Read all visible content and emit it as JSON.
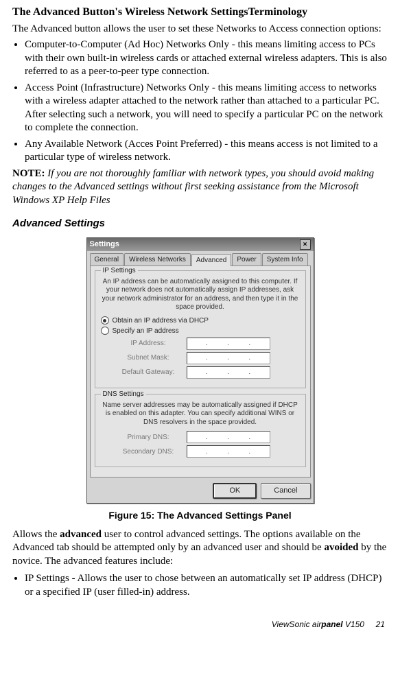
{
  "heading": "The Advanced Button's Wireless Network SettingsTerminology",
  "intro": "The Advanced button allows the user to set these Networks to Access connection options:",
  "bullets": [
    " Computer-to-Computer (Ad Hoc) Networks Only - this means limiting access to PCs with their own built-in wireless cards or attached external wireless adapters. This is also referred to as a peer-to-peer type connection.",
    "Access Point (Infrastructure) Networks Only - this means limiting access to networks with a wireless adapter attached to the network rather than attached to a particular PC. After selecting such a network, you will need to specify a particular PC on the network to complete the connection.",
    "Any Available Network (Acces Point Preferred) - this means access is not limited to a particular type of wireless network."
  ],
  "note_label": "NOTE:",
  "note_text": "If you are not thoroughly familiar with network types, you should avoid making changes to the Advanced settings without first seeking assistance from the Microsoft Windows XP Help Files",
  "section_title": "Advanced Settings",
  "caption": "Figure 15: The Advanced Settings Panel",
  "after_fig_p1a": "Allows the ",
  "after_fig_p1b": "advanced",
  "after_fig_p1c": " user to control advanced settings. The options available on the Advanced tab should be attempted only by an advanced user and should be ",
  "after_fig_p1d": "avoided",
  "after_fig_p1e": " by the novice. The advanced features include:",
  "after_bullets": [
    "IP Settings - Allows the user to chose between an automatically set IP address (DHCP) or a specified IP (user filled-in) address."
  ],
  "footer": {
    "brand": "ViewSonic ",
    "air": "air",
    "panel": "panel",
    "model": " V150",
    "page": "21"
  },
  "dialog": {
    "title": "Settings",
    "tabs": [
      "General",
      "Wireless Networks",
      "Advanced",
      "Power",
      "System Info"
    ],
    "active_tab": 2,
    "ip_group": {
      "title": "IP Settings",
      "desc": "An IP address can be automatically assigned to this computer.  If your network does not automatically assign IP addresses, ask your network administrator for an address, and then type it in the space provided.",
      "radio1": "Obtain an IP address via DHCP",
      "radio2": "Specify an IP address",
      "fields": {
        "ip": "IP Address:",
        "mask": "Subnet Mask:",
        "gw": "Default Gateway:"
      }
    },
    "dns_group": {
      "title": "DNS Settings",
      "desc": "Name server addresses may be automatically assigned if DHCP is enabled on this adapter.  You can specify additional WINS or DNS resolvers in the space provided.",
      "fields": {
        "primary": "Primary DNS:",
        "secondary": "Secondary DNS:"
      }
    },
    "buttons": {
      "ok": "OK",
      "cancel": "Cancel"
    }
  }
}
